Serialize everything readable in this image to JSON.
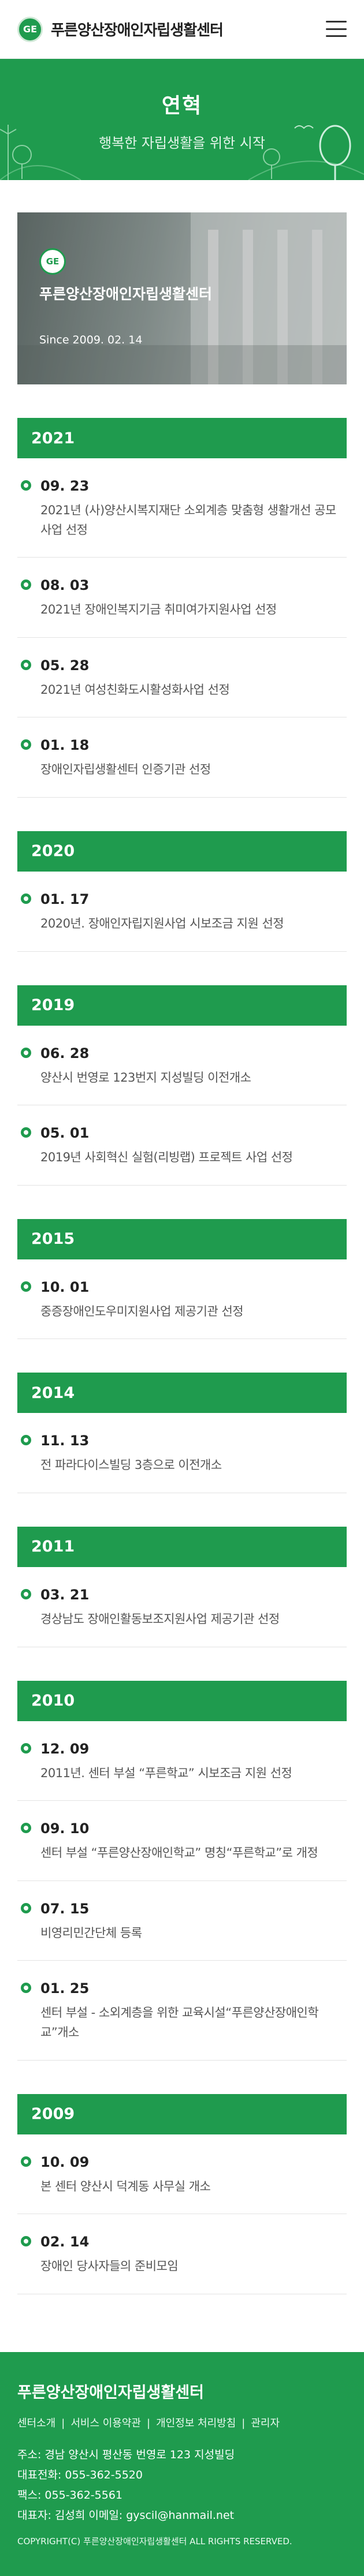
{
  "header": {
    "logo_text": "GE",
    "site_name": "푸른양산장애인자립생활센터",
    "menu_icon": "hamburger-icon"
  },
  "hero": {
    "title": "연혁",
    "subtitle": "행복한 자립생활을 위한 시작"
  },
  "banner": {
    "logo_text": "GE",
    "title": "푸른양산장애인자립생활센터",
    "since": "Since 2009. 02. 14"
  },
  "history": [
    {
      "year": "2021",
      "events": [
        {
          "date": "09. 23",
          "desc": "2021년 (사)양산시복지재단 소외계층 맞춤형 생활개선 공모사업 선정"
        },
        {
          "date": "08. 03",
          "desc": "2021년 장애인복지기금 취미여가지원사업 선정"
        },
        {
          "date": "05. 28",
          "desc": "2021년 여성친화도시활성화사업 선정"
        },
        {
          "date": "01. 18",
          "desc": "장애인자립생활센터 인증기관 선정"
        }
      ]
    },
    {
      "year": "2020",
      "events": [
        {
          "date": "01. 17",
          "desc": "2020년. 장애인자립지원사업 시보조금 지원 선정"
        }
      ]
    },
    {
      "year": "2019",
      "events": [
        {
          "date": "06. 28",
          "desc": "양산시 번영로 123번지 지성빌딩 이전개소"
        },
        {
          "date": "05. 01",
          "desc": "2019년 사회혁신 실험(리빙랩) 프로젝트 사업 선정"
        }
      ]
    },
    {
      "year": "2015",
      "events": [
        {
          "date": "10. 01",
          "desc": "중증장애인도우미지원사업 제공기관 선정"
        }
      ]
    },
    {
      "year": "2014",
      "events": [
        {
          "date": "11. 13",
          "desc": "전 파라다이스빌딩 3층으로 이전개소"
        }
      ]
    },
    {
      "year": "2011",
      "events": [
        {
          "date": "03. 21",
          "desc": "경상남도 장애인활동보조지원사업 제공기관 선정"
        }
      ]
    },
    {
      "year": "2010",
      "events": [
        {
          "date": "12. 09",
          "desc": "2011년. 센터 부설 “푸른학교” 시보조금 지원 선정"
        },
        {
          "date": "09. 10",
          "desc": "센터 부설 “푸른양산장애인학교” 명칭“푸른학교”로 개정"
        },
        {
          "date": "07. 15",
          "desc": "비영리민간단체 등록"
        },
        {
          "date": "01. 25",
          "desc": "센터 부설 - 소외계층을 위한 교육시설“푸른양산장애인학교”개소"
        }
      ]
    },
    {
      "year": "2009",
      "events": [
        {
          "date": "10. 09",
          "desc": "본 센터 양산시 덕계동 사무실 개소"
        },
        {
          "date": "02. 14",
          "desc": "장애인 당사자들의 준비모임"
        }
      ]
    }
  ],
  "footer": {
    "name": "푸른양산장애인자립생활센터",
    "links": [
      "센터소개",
      "서비스 이용약관",
      "개인정보 처리방침",
      "관리자"
    ],
    "address": "주소: 경남 양산시 평산동 번영로 123 지성빌딩",
    "phone": "대표전화: 055-362-5520",
    "fax": "팩스: 055-362-5561",
    "rep_email": "대표자: 김성희    이메일: gyscil@hanmail.net",
    "copyright": "COPYRIGHT(C) 푸른양산장애인자립생활센터 ALL RIGHTS RESERVED."
  },
  "colors": {
    "brand_green": "#1f9b4e"
  }
}
